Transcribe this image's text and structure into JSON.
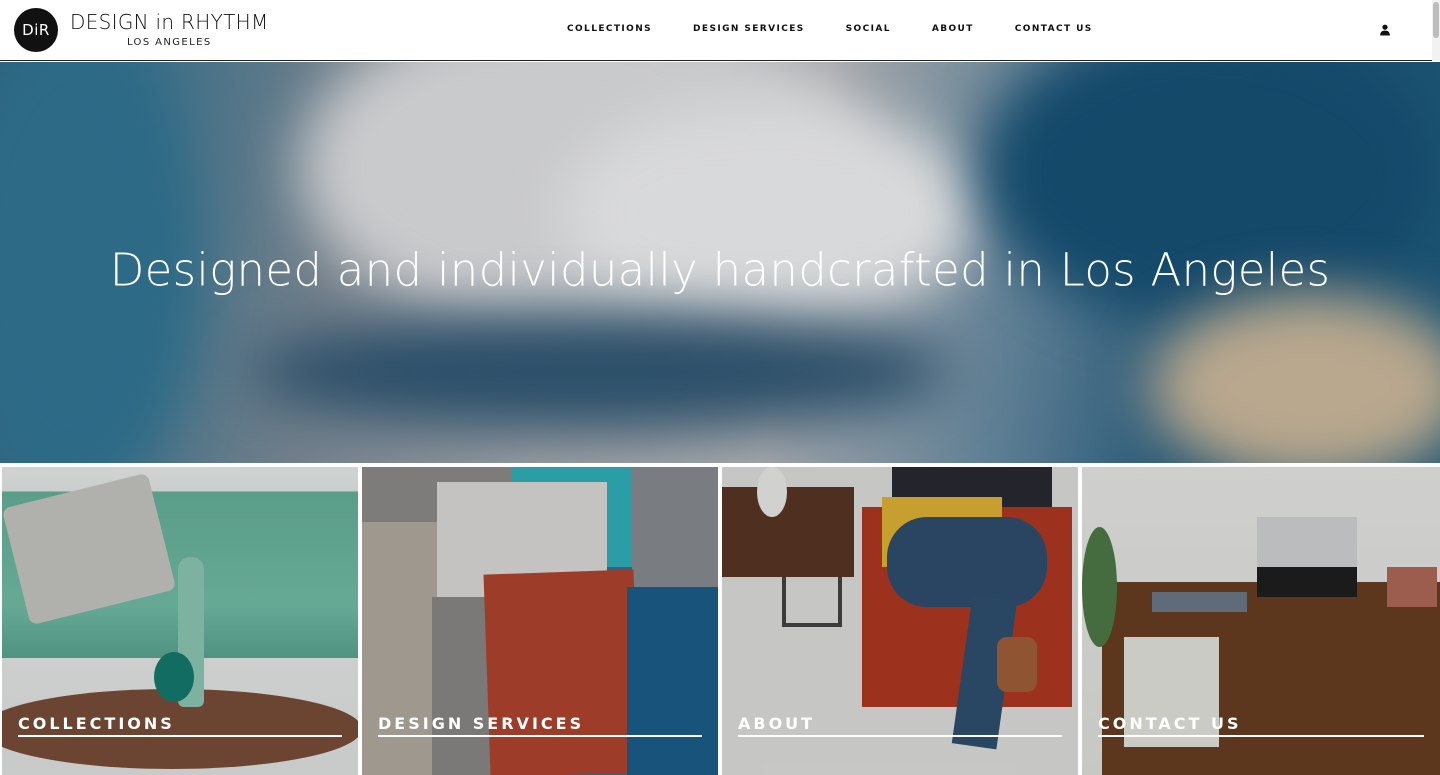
{
  "brand": {
    "mark": "DiR",
    "name": "DESIGN in RHYTHM",
    "location": "LOS ANGELES"
  },
  "nav": {
    "items": [
      {
        "label": "COLLECTIONS"
      },
      {
        "label": "DESIGN SERVICES"
      },
      {
        "label": "SOCIAL"
      },
      {
        "label": "ABOUT"
      },
      {
        "label": "CONTACT US"
      }
    ],
    "account_icon": "user-icon"
  },
  "hero": {
    "headline": "Designed and individually handcrafted in Los Angeles"
  },
  "tiles": [
    {
      "label": "COLLECTIONS"
    },
    {
      "label": "DESIGN SERVICES"
    },
    {
      "label": "ABOUT"
    },
    {
      "label": "CONTACT US"
    }
  ],
  "colors": {
    "header_bg": "#ffffff",
    "text_dark": "#111111",
    "hero_teal": "#1d5473",
    "overlay_text": "#ffffff"
  }
}
